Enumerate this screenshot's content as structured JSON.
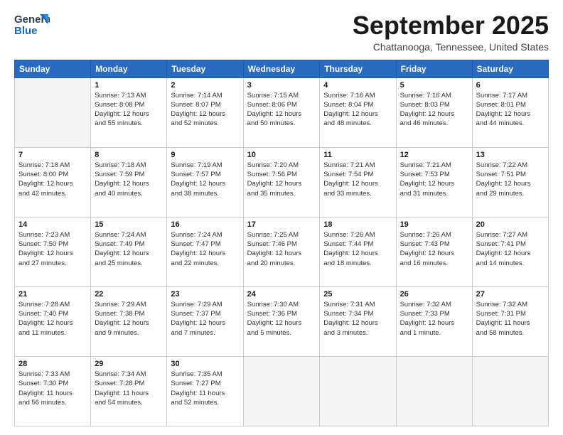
{
  "header": {
    "logo_line1": "General",
    "logo_line2": "Blue",
    "month_title": "September 2025",
    "location": "Chattanooga, Tennessee, United States"
  },
  "weekdays": [
    "Sunday",
    "Monday",
    "Tuesday",
    "Wednesday",
    "Thursday",
    "Friday",
    "Saturday"
  ],
  "weeks": [
    [
      {
        "day": "",
        "info": ""
      },
      {
        "day": "1",
        "info": "Sunrise: 7:13 AM\nSunset: 8:08 PM\nDaylight: 12 hours\nand 55 minutes."
      },
      {
        "day": "2",
        "info": "Sunrise: 7:14 AM\nSunset: 8:07 PM\nDaylight: 12 hours\nand 52 minutes."
      },
      {
        "day": "3",
        "info": "Sunrise: 7:15 AM\nSunset: 8:06 PM\nDaylight: 12 hours\nand 50 minutes."
      },
      {
        "day": "4",
        "info": "Sunrise: 7:16 AM\nSunset: 8:04 PM\nDaylight: 12 hours\nand 48 minutes."
      },
      {
        "day": "5",
        "info": "Sunrise: 7:16 AM\nSunset: 8:03 PM\nDaylight: 12 hours\nand 46 minutes."
      },
      {
        "day": "6",
        "info": "Sunrise: 7:17 AM\nSunset: 8:01 PM\nDaylight: 12 hours\nand 44 minutes."
      }
    ],
    [
      {
        "day": "7",
        "info": "Sunrise: 7:18 AM\nSunset: 8:00 PM\nDaylight: 12 hours\nand 42 minutes."
      },
      {
        "day": "8",
        "info": "Sunrise: 7:18 AM\nSunset: 7:59 PM\nDaylight: 12 hours\nand 40 minutes."
      },
      {
        "day": "9",
        "info": "Sunrise: 7:19 AM\nSunset: 7:57 PM\nDaylight: 12 hours\nand 38 minutes."
      },
      {
        "day": "10",
        "info": "Sunrise: 7:20 AM\nSunset: 7:56 PM\nDaylight: 12 hours\nand 35 minutes."
      },
      {
        "day": "11",
        "info": "Sunrise: 7:21 AM\nSunset: 7:54 PM\nDaylight: 12 hours\nand 33 minutes."
      },
      {
        "day": "12",
        "info": "Sunrise: 7:21 AM\nSunset: 7:53 PM\nDaylight: 12 hours\nand 31 minutes."
      },
      {
        "day": "13",
        "info": "Sunrise: 7:22 AM\nSunset: 7:51 PM\nDaylight: 12 hours\nand 29 minutes."
      }
    ],
    [
      {
        "day": "14",
        "info": "Sunrise: 7:23 AM\nSunset: 7:50 PM\nDaylight: 12 hours\nand 27 minutes."
      },
      {
        "day": "15",
        "info": "Sunrise: 7:24 AM\nSunset: 7:49 PM\nDaylight: 12 hours\nand 25 minutes."
      },
      {
        "day": "16",
        "info": "Sunrise: 7:24 AM\nSunset: 7:47 PM\nDaylight: 12 hours\nand 22 minutes."
      },
      {
        "day": "17",
        "info": "Sunrise: 7:25 AM\nSunset: 7:46 PM\nDaylight: 12 hours\nand 20 minutes."
      },
      {
        "day": "18",
        "info": "Sunrise: 7:26 AM\nSunset: 7:44 PM\nDaylight: 12 hours\nand 18 minutes."
      },
      {
        "day": "19",
        "info": "Sunrise: 7:26 AM\nSunset: 7:43 PM\nDaylight: 12 hours\nand 16 minutes."
      },
      {
        "day": "20",
        "info": "Sunrise: 7:27 AM\nSunset: 7:41 PM\nDaylight: 12 hours\nand 14 minutes."
      }
    ],
    [
      {
        "day": "21",
        "info": "Sunrise: 7:28 AM\nSunset: 7:40 PM\nDaylight: 12 hours\nand 11 minutes."
      },
      {
        "day": "22",
        "info": "Sunrise: 7:29 AM\nSunset: 7:38 PM\nDaylight: 12 hours\nand 9 minutes."
      },
      {
        "day": "23",
        "info": "Sunrise: 7:29 AM\nSunset: 7:37 PM\nDaylight: 12 hours\nand 7 minutes."
      },
      {
        "day": "24",
        "info": "Sunrise: 7:30 AM\nSunset: 7:36 PM\nDaylight: 12 hours\nand 5 minutes."
      },
      {
        "day": "25",
        "info": "Sunrise: 7:31 AM\nSunset: 7:34 PM\nDaylight: 12 hours\nand 3 minutes."
      },
      {
        "day": "26",
        "info": "Sunrise: 7:32 AM\nSunset: 7:33 PM\nDaylight: 12 hours\nand 1 minute."
      },
      {
        "day": "27",
        "info": "Sunrise: 7:32 AM\nSunset: 7:31 PM\nDaylight: 11 hours\nand 58 minutes."
      }
    ],
    [
      {
        "day": "28",
        "info": "Sunrise: 7:33 AM\nSunset: 7:30 PM\nDaylight: 11 hours\nand 56 minutes."
      },
      {
        "day": "29",
        "info": "Sunrise: 7:34 AM\nSunset: 7:28 PM\nDaylight: 11 hours\nand 54 minutes."
      },
      {
        "day": "30",
        "info": "Sunrise: 7:35 AM\nSunset: 7:27 PM\nDaylight: 11 hours\nand 52 minutes."
      },
      {
        "day": "",
        "info": ""
      },
      {
        "day": "",
        "info": ""
      },
      {
        "day": "",
        "info": ""
      },
      {
        "day": "",
        "info": ""
      }
    ]
  ]
}
